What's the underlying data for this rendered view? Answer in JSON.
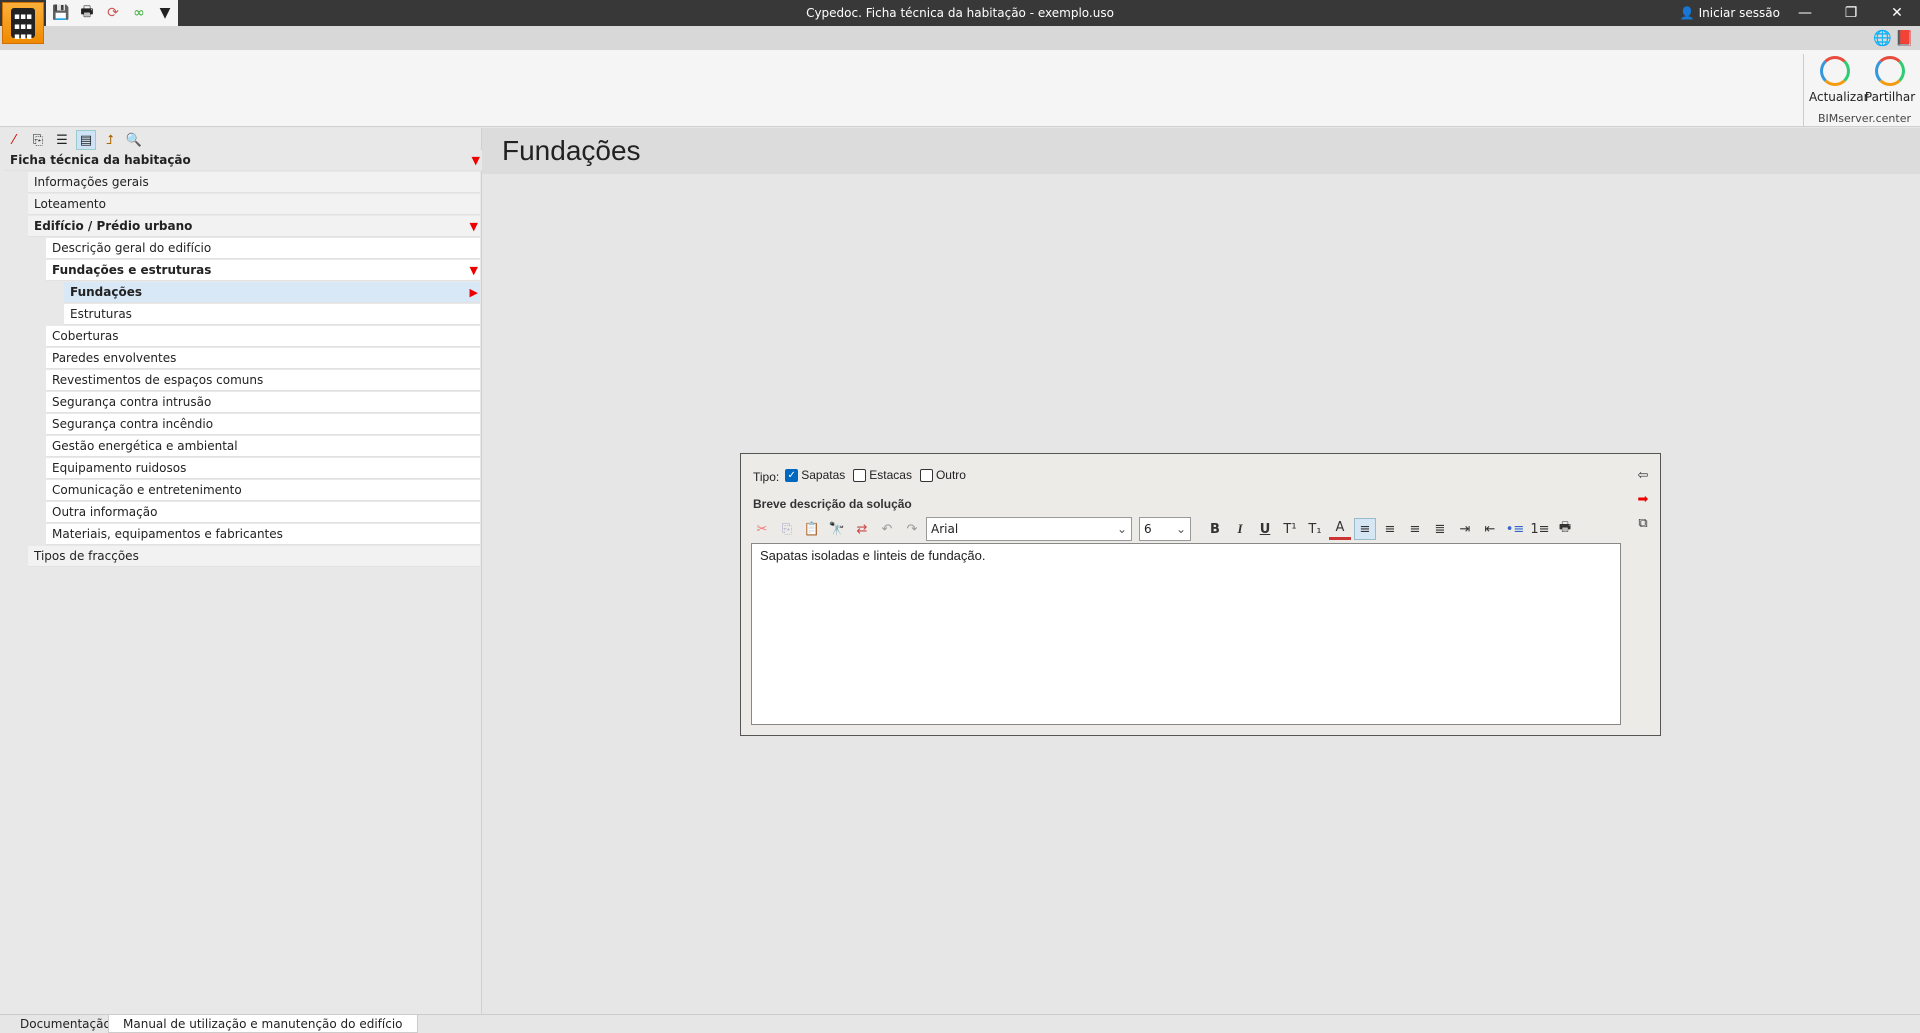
{
  "window": {
    "title": "Cypedoc. Ficha técnica da habitação - exemplo.uso",
    "login": "Iniciar sessão"
  },
  "ribbon": {
    "update": "Actualizar",
    "share": "Partilhar",
    "group": "BIMserver.center"
  },
  "tree": {
    "root": "Ficha técnica da habitação",
    "items": [
      {
        "label": "Informações gerais",
        "level": 1,
        "bold": false
      },
      {
        "label": "Loteamento",
        "level": 1,
        "bold": false
      },
      {
        "label": "Edifício / Prédio urbano",
        "level": 1,
        "bold": true,
        "expanded": true
      },
      {
        "label": "Descrição geral do edifício",
        "level": 2,
        "bold": false
      },
      {
        "label": "Fundações e estruturas",
        "level": 2,
        "bold": true,
        "expanded": true
      },
      {
        "label": "Fundações",
        "level": 3,
        "bold": true,
        "selected": true
      },
      {
        "label": "Estruturas",
        "level": 3,
        "bold": false
      },
      {
        "label": "Coberturas",
        "level": 2,
        "bold": false
      },
      {
        "label": "Paredes envolventes",
        "level": 2,
        "bold": false
      },
      {
        "label": "Revestimentos de espaços comuns",
        "level": 2,
        "bold": false
      },
      {
        "label": "Segurança contra intrusão",
        "level": 2,
        "bold": false
      },
      {
        "label": "Segurança contra incêndio",
        "level": 2,
        "bold": false
      },
      {
        "label": "Gestão energética e ambiental",
        "level": 2,
        "bold": false
      },
      {
        "label": "Equipamento ruidosos",
        "level": 2,
        "bold": false
      },
      {
        "label": "Comunicação e entretenimento",
        "level": 2,
        "bold": false
      },
      {
        "label": "Outra informação",
        "level": 2,
        "bold": false
      },
      {
        "label": "Materiais, equipamentos e fabricantes",
        "level": 2,
        "bold": false
      },
      {
        "label": "Tipos de fracções",
        "level": 1,
        "bold": false
      }
    ]
  },
  "main": {
    "title": "Fundações"
  },
  "form": {
    "tipo_label": "Tipo:",
    "options": [
      {
        "label": "Sapatas",
        "checked": true
      },
      {
        "label": "Estacas",
        "checked": false
      },
      {
        "label": "Outro",
        "checked": false
      }
    ],
    "desc_label": "Breve descrição da solução",
    "font": "Arial",
    "size": "6",
    "text": "Sapatas isoladas e linteis de fundação."
  },
  "tabs": [
    "Documentação",
    "Manual de utilização e manutenção do edifício"
  ]
}
